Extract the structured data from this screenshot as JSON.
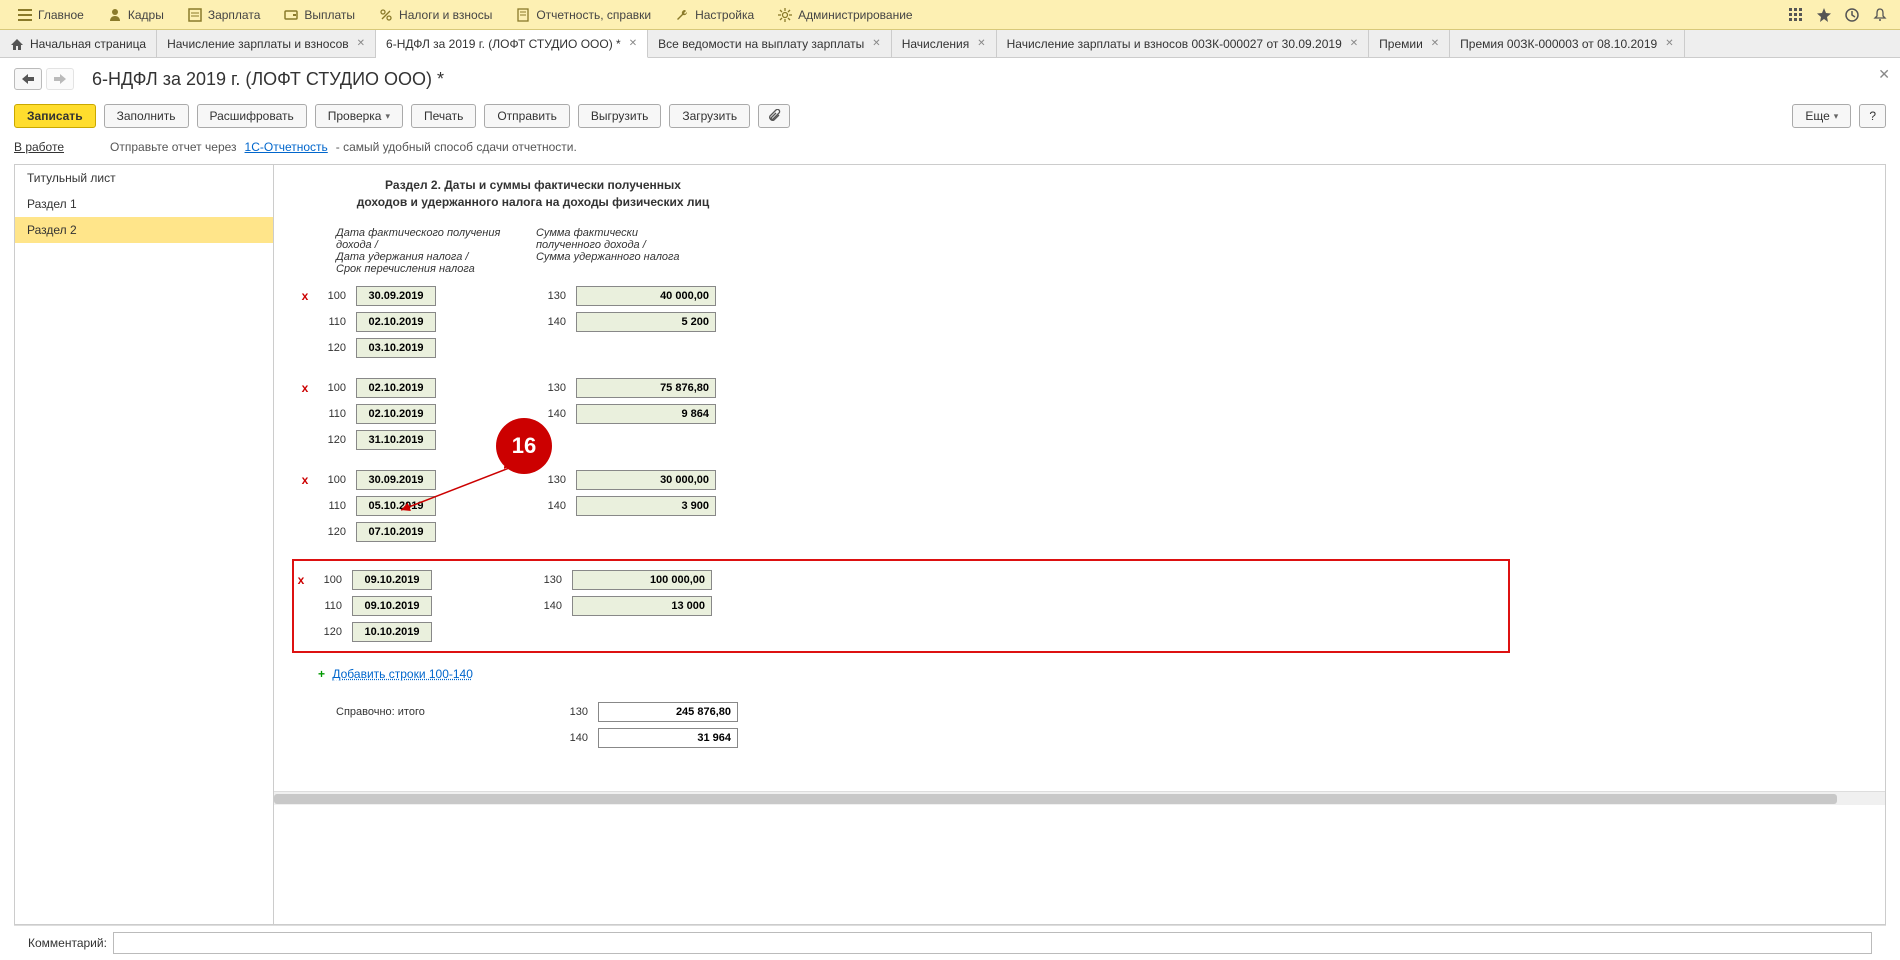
{
  "topmenu": [
    {
      "label": "Главное",
      "icon": "menu"
    },
    {
      "label": "Кадры",
      "icon": "person"
    },
    {
      "label": "Зарплата",
      "icon": "list"
    },
    {
      "label": "Выплаты",
      "icon": "wallet"
    },
    {
      "label": "Налоги и взносы",
      "icon": "percent"
    },
    {
      "label": "Отчетность, справки",
      "icon": "doc"
    },
    {
      "label": "Настройка",
      "icon": "wrench"
    },
    {
      "label": "Администрирование",
      "icon": "gear"
    }
  ],
  "tabs": [
    {
      "label": "Начальная страница",
      "home": true,
      "closable": false
    },
    {
      "label": "Начисление зарплаты и взносов",
      "closable": true
    },
    {
      "label": "6-НДФЛ за 2019 г. (ЛОФТ СТУДИО ООО) *",
      "closable": true,
      "active": true
    },
    {
      "label": "Все ведомости на выплату зарплаты",
      "closable": true
    },
    {
      "label": "Начисления",
      "closable": true
    },
    {
      "label": "Начисление зарплаты и взносов 00ЗК-000027 от 30.09.2019",
      "closable": true
    },
    {
      "label": "Премии",
      "closable": true
    },
    {
      "label": "Премия 00ЗК-000003 от 08.10.2019",
      "closable": true
    }
  ],
  "page": {
    "title": "6-НДФЛ за 2019 г. (ЛОФТ СТУДИО ООО) *"
  },
  "toolbar": {
    "write": "Записать",
    "fill": "Заполнить",
    "decrypt": "Расшифровать",
    "check": "Проверка",
    "print": "Печать",
    "send": "Отправить",
    "export": "Выгрузить",
    "import": "Загрузить",
    "more": "Еще",
    "help": "?"
  },
  "status": {
    "label": "В работе",
    "hint1": "Отправьте отчет через ",
    "link": "1С-Отчетность",
    "hint2": " - самый удобный способ сдачи отчетности."
  },
  "sidenav": [
    {
      "label": "Титульный лист"
    },
    {
      "label": "Раздел 1"
    },
    {
      "label": "Раздел 2",
      "active": true
    }
  ],
  "section": {
    "title1": "Раздел 2.  Даты и суммы фактически полученных",
    "title2": "доходов и удержанного налога на доходы физических лиц",
    "colh1a": "Дата фактического получения дохода /",
    "colh1b": "Дата удержания налога /",
    "colh1c": "Срок перечисления налога",
    "colh2a": "Сумма фактически",
    "colh2b": "полученного дохода /",
    "colh2c": "Сумма удержанного налога"
  },
  "blocks": [
    {
      "r100d": "30.09.2019",
      "r130": "40 000,00",
      "r110d": "02.10.2019",
      "r140": "5 200",
      "r120d": "03.10.2019"
    },
    {
      "r100d": "02.10.2019",
      "r130": "75 876,80",
      "r110d": "02.10.2019",
      "r140": "9 864",
      "r120d": "31.10.2019"
    },
    {
      "r100d": "30.09.2019",
      "r130": "30 000,00",
      "r110d": "05.10.2019",
      "r140": "3 900",
      "r120d": "07.10.2019"
    },
    {
      "r100d": "09.10.2019",
      "r130": "100 000,00",
      "r110d": "09.10.2019",
      "r140": "13 000",
      "r120d": "10.10.2019",
      "highlight": true
    }
  ],
  "codes": {
    "c100": "100",
    "c110": "110",
    "c120": "120",
    "c130": "130",
    "c140": "140"
  },
  "addrows": "Добавить строки 100-140",
  "totals": {
    "label": "Справочно: итого",
    "t130": "245 876,80",
    "t140": "31 964"
  },
  "callout": "16",
  "footer": {
    "label": "Комментарий:"
  }
}
